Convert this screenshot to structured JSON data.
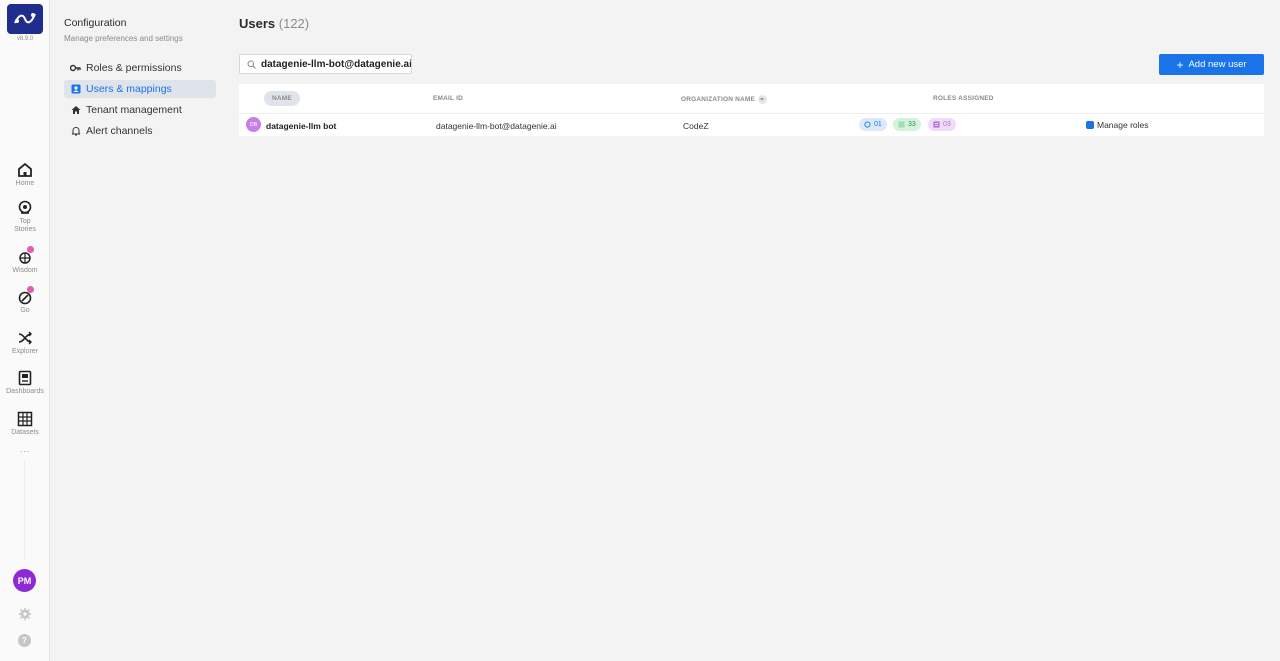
{
  "app": {
    "version": "v8.9.0"
  },
  "nav": [
    {
      "id": "home",
      "label": "Home"
    },
    {
      "id": "top-stories",
      "label": "Top Stories"
    },
    {
      "id": "wisdom",
      "label": "Wisdom"
    },
    {
      "id": "go",
      "label": "Go"
    },
    {
      "id": "explorer",
      "label": "Explorer"
    },
    {
      "id": "dashboards",
      "label": "Dashboards"
    },
    {
      "id": "datasets",
      "label": "Datasets"
    }
  ],
  "more": "...",
  "user_initials": "PM",
  "help_glyph": "?",
  "config": {
    "title": "Configuration",
    "subtitle": "Manage preferences and settings",
    "menu": [
      {
        "label": "Roles & permissions",
        "icon": "key-icon"
      },
      {
        "label": "Users & mappings",
        "icon": "user-badge-icon",
        "active": true
      },
      {
        "label": "Tenant management",
        "icon": "house-icon"
      },
      {
        "label": "Alert channels",
        "icon": "bell-icon"
      }
    ]
  },
  "main": {
    "title": "Users",
    "count": "(122)",
    "search_value": "datagenie-llm-bot@datagenie.ai",
    "add_button": "Add new user",
    "add_button_icon": "+",
    "columns": {
      "name": "NAME",
      "email": "EMAIL ID",
      "org": "ORGANIZATION NAME",
      "roles": "ROLES ASSIGNED"
    },
    "rows": [
      {
        "initials": "DB",
        "name": "datagenie-llm bot",
        "email": "datagenie-llm-bot@datagenie.ai",
        "org": "CodeZ",
        "chip_blue": "01",
        "chip_green": "33",
        "chip_purple": "03",
        "action": "Manage roles"
      }
    ]
  },
  "colors": {
    "accent": "#1a73e8",
    "logo_bg": "#1f2d8c",
    "avatar": "#8b2ad6"
  }
}
